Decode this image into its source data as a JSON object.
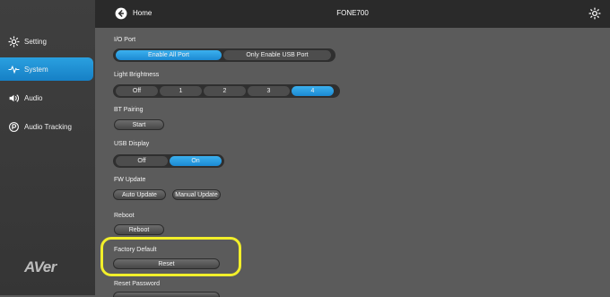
{
  "header": {
    "home_label": "Home",
    "device_name": "FONE700"
  },
  "sidebar": {
    "items": [
      {
        "label": "Setting",
        "icon": "gear-icon",
        "active": false
      },
      {
        "label": "System",
        "icon": "pulse-icon",
        "active": true
      },
      {
        "label": "Audio",
        "icon": "speaker-icon",
        "active": false
      },
      {
        "label": "Audio Tracking",
        "icon": "audio-tracking-icon",
        "active": false
      }
    ],
    "logo": "AVer"
  },
  "sections": {
    "io_port": {
      "label": "I/O Port",
      "options": [
        "Enable All Port",
        "Only Enable USB Port"
      ],
      "selected": "Enable All Port"
    },
    "light_brightness": {
      "label": "Light Brightness",
      "options": [
        "Off",
        "1",
        "2",
        "3",
        "4"
      ],
      "selected": "4"
    },
    "bt_pairing": {
      "label": "BT Pairing",
      "button": "Start"
    },
    "usb_display": {
      "label": "USB Display",
      "options": [
        "Off",
        "On"
      ],
      "selected": "On"
    },
    "fw_update": {
      "label": "FW Update",
      "buttons": [
        "Auto Update",
        "Manual Update"
      ]
    },
    "reboot": {
      "label": "Reboot",
      "button": "Reboot"
    },
    "factory_default": {
      "label": "Factory Default",
      "button": "Reset"
    },
    "reset_password": {
      "label": "Reset Password"
    }
  },
  "colors": {
    "accent": "#1c8ad3",
    "highlight": "#f2ef2a",
    "sidebar_bg": "#3a3a3a",
    "topbar_bg": "#2a2a2a",
    "content_bg": "#5b5b5b"
  }
}
